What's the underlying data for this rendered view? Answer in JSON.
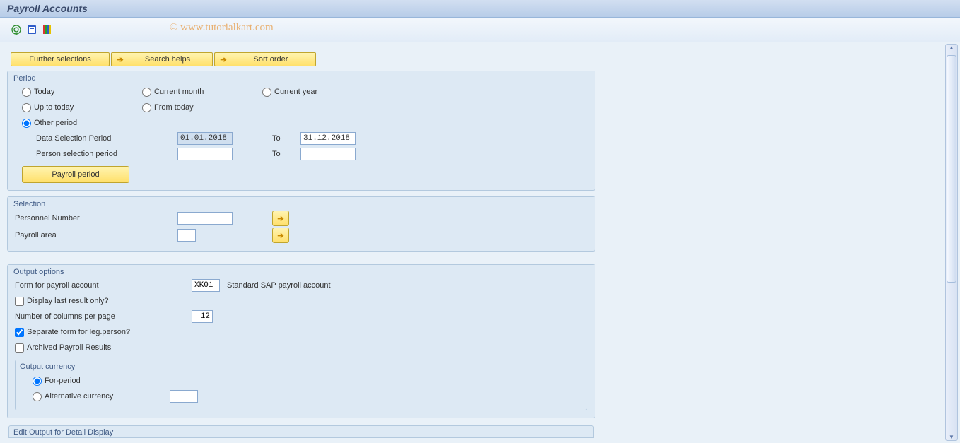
{
  "title": "Payroll Accounts",
  "watermark": "© www.tutorialkart.com",
  "toolbar_icons": {
    "execute": "execute-icon",
    "variant": "variant-icon",
    "params": "params-icon"
  },
  "selection_buttons": {
    "further": "Further selections",
    "search": "Search helps",
    "sort": "Sort order"
  },
  "period": {
    "legend": "Period",
    "today": "Today",
    "current_month": "Current month",
    "current_year": "Current year",
    "up_to_today": "Up to today",
    "from_today": "From today",
    "other_period": "Other period",
    "data_sel_label": "Data Selection Period",
    "person_sel_label": "Person selection period",
    "to_label": "To",
    "data_from": "01.01.2018",
    "data_to": "31.12.2018",
    "person_from": "",
    "person_to": "",
    "payroll_period_btn": "Payroll period"
  },
  "selection": {
    "legend": "Selection",
    "personnel_number": "Personnel Number",
    "payroll_area": "Payroll area",
    "personnel_value": "",
    "payroll_value": ""
  },
  "output": {
    "legend": "Output options",
    "form_label": "Form for payroll account",
    "form_code": "XK01",
    "form_desc": "Standard SAP payroll account",
    "display_last_label": "Display last result only?",
    "display_last": false,
    "num_cols_label": "Number of columns per page",
    "num_cols": "12",
    "sep_form_label": "Separate form for leg.person?",
    "sep_form": true,
    "archived_label": "Archived Payroll Results",
    "archived": false,
    "currency_legend": "Output currency",
    "for_period": "For-period",
    "alt_currency": "Alternative currency",
    "alt_currency_value": ""
  },
  "edit_output_legend": "Edit Output for Detail Display"
}
